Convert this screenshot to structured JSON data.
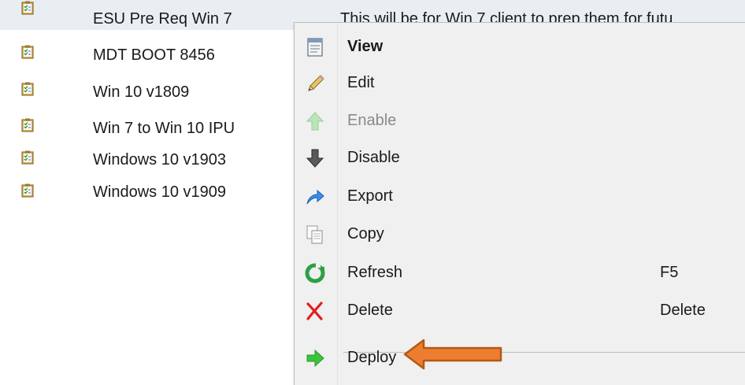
{
  "list": {
    "items": [
      {
        "name": "ESU Pre Req Win 7",
        "description": "This will be for Win 7 client to prep them for futu"
      },
      {
        "name": "MDT BOOT 8456",
        "description": ""
      },
      {
        "name": "Win 10 v1809",
        "description": ""
      },
      {
        "name": "Win 7 to Win 10 IPU",
        "description": ""
      },
      {
        "name": "Windows 10 v1903",
        "description": ""
      },
      {
        "name": "Windows 10 v1909",
        "description": ""
      }
    ]
  },
  "context_menu": {
    "items": [
      {
        "label": "View",
        "icon": "view-icon",
        "bold": true
      },
      {
        "label": "Edit",
        "icon": "pencil-icon"
      },
      {
        "label": "Enable",
        "icon": "enable-arrow-up-icon",
        "disabled": true
      },
      {
        "label": "Disable",
        "icon": "disable-arrow-down-icon"
      },
      {
        "label": "Export",
        "icon": "export-arrow-icon"
      },
      {
        "label": "Copy",
        "icon": "copy-icon"
      },
      {
        "label": "Refresh",
        "icon": "refresh-icon",
        "shortcut": "F5"
      },
      {
        "label": "Delete",
        "icon": "delete-x-icon",
        "shortcut": "Delete"
      },
      {
        "label": "Deploy",
        "icon": "deploy-arrow-icon"
      }
    ]
  },
  "colors": {
    "menu_bg": "#f0f0f0",
    "selection_bg": "#e9eef3",
    "annotation_arrow": "#ed7d31",
    "delete_red": "#e02020",
    "deploy_green": "#3cc23c"
  }
}
